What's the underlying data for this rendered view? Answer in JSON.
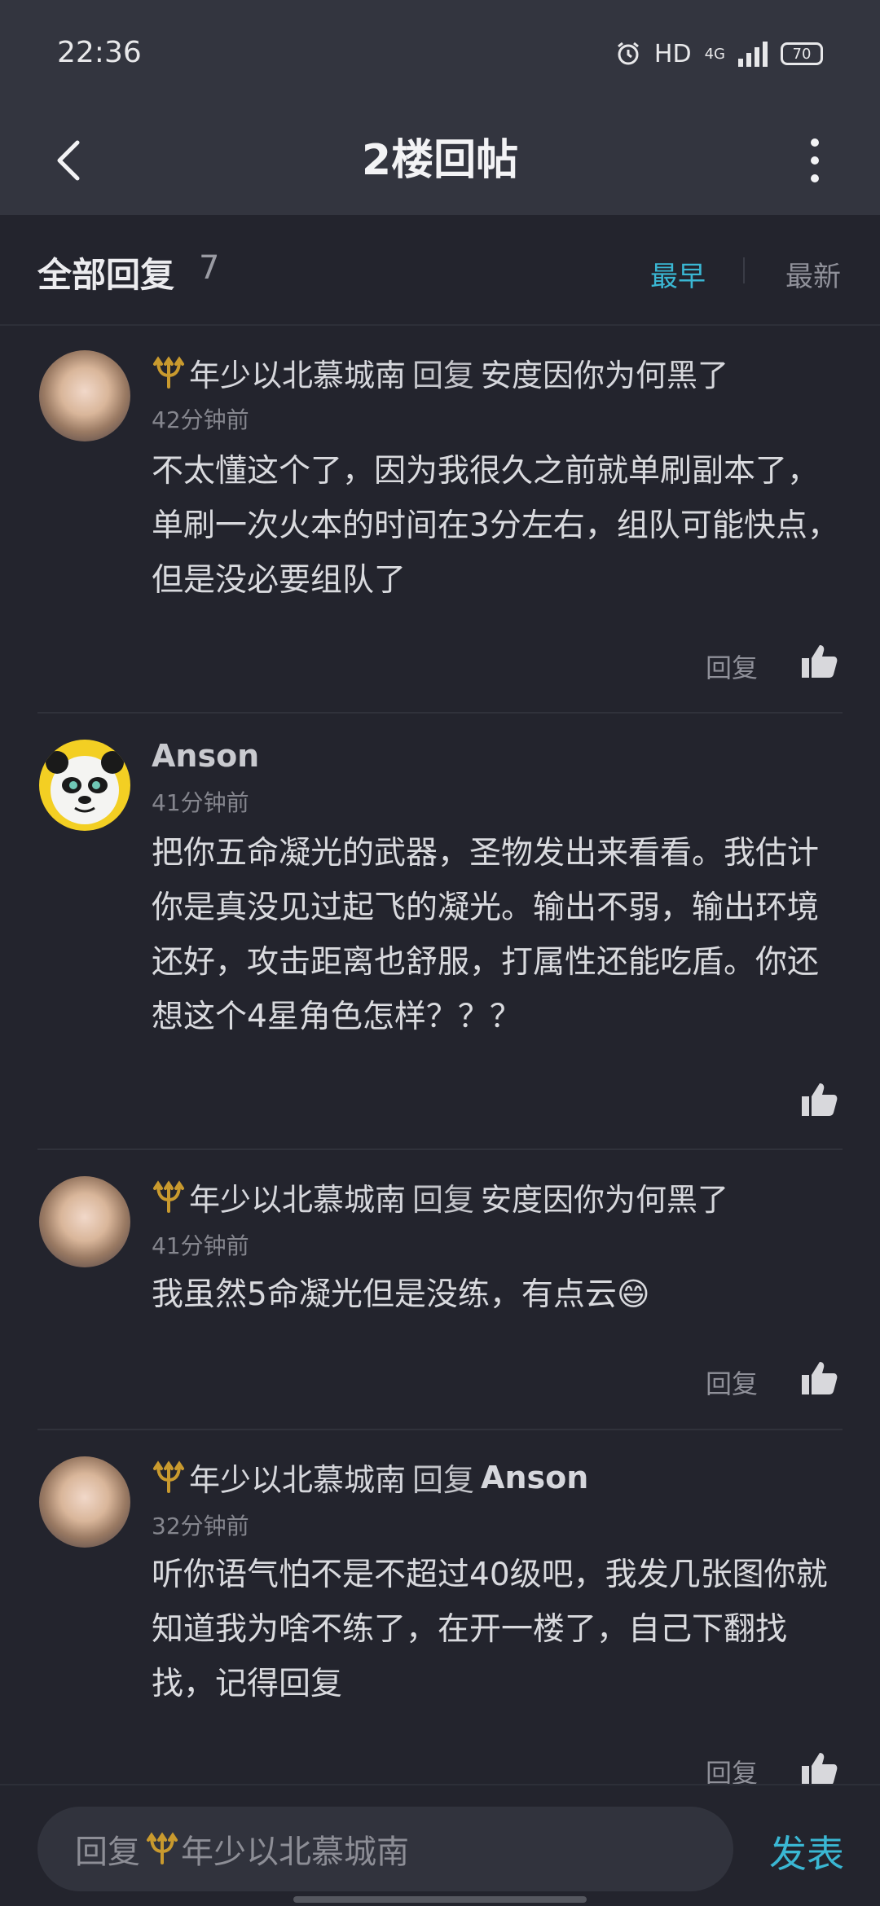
{
  "status": {
    "time": "22:36",
    "hd": "HD",
    "network": "4G",
    "battery": "70"
  },
  "nav": {
    "title": "2楼回帖"
  },
  "filter": {
    "label": "全部回复",
    "count": "7",
    "sort_early": "最早",
    "sort_new": "最新"
  },
  "comments": [
    {
      "name": "年少以北慕城南",
      "reply_word": "回复",
      "reply_to": "安度因你为何黑了",
      "time": "42分钟前",
      "content": "不太懂这个了，因为我很久之前就单刷副本了，单刷一次火本的时间在3分左右，组队可能快点，但是没必要组队了",
      "reply_label": "回复"
    },
    {
      "name": "Anson",
      "time": "41分钟前",
      "content": "把你五命凝光的武器，圣物发出来看看。我估计你是真没见过起飞的凝光。输出不弱，输出环境还好，攻击距离也舒服，打属性还能吃盾。你还想这个4星角色怎样？？？"
    },
    {
      "name": "年少以北慕城南",
      "reply_word": "回复",
      "reply_to": "安度因你为何黑了",
      "time": "41分钟前",
      "content": "我虽然5命凝光但是没练，有点云😄",
      "reply_label": "回复"
    },
    {
      "name": "年少以北慕城南",
      "reply_word": "回复",
      "reply_to": "Anson",
      "time": "32分钟前",
      "content": "听你语气怕不是不超过40级吧，我发几张图你就知道我为啥不练了，在开一楼了，自己下翻找找，记得回复",
      "reply_label": "回复"
    }
  ],
  "bottom": {
    "placeholder_prefix": "回复",
    "placeholder_name": "年少以北慕城南",
    "send_label": "发表"
  },
  "colors": {
    "accent": "#3ab7d3",
    "background": "#23242d",
    "header": "#33353f",
    "trident": "#c99a2e"
  }
}
